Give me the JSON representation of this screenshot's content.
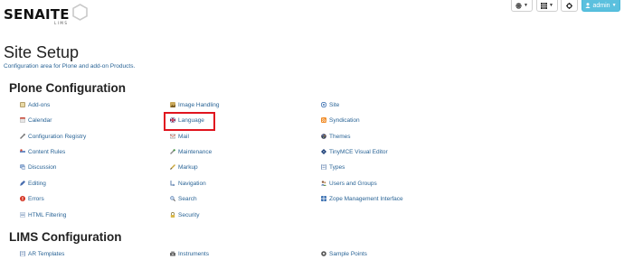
{
  "brand": {
    "name": "SENAITE",
    "sub": "LIMS"
  },
  "toolbar": {
    "admin_label": "admin"
  },
  "page": {
    "title": "Site Setup",
    "description": "Configuration area for Plone and add-on Products."
  },
  "plone_config": {
    "title": "Plone Configuration",
    "col1": [
      {
        "label": "Add-ons",
        "icon": "addons-icon"
      },
      {
        "label": "Calendar",
        "icon": "calendar-icon"
      },
      {
        "label": "Configuration Registry",
        "icon": "wrench-icon"
      },
      {
        "label": "Content Rules",
        "icon": "content-rules-icon"
      },
      {
        "label": "Discussion",
        "icon": "discussion-icon"
      },
      {
        "label": "Editing",
        "icon": "editing-icon"
      },
      {
        "label": "Errors",
        "icon": "errors-icon"
      },
      {
        "label": "HTML Filtering",
        "icon": "html-filtering-icon"
      }
    ],
    "col2": [
      {
        "label": "Image Handling",
        "icon": "image-icon"
      },
      {
        "label": "Language",
        "icon": "flag-icon"
      },
      {
        "label": "Mail",
        "icon": "mail-icon"
      },
      {
        "label": "Maintenance",
        "icon": "maintenance-icon"
      },
      {
        "label": "Markup",
        "icon": "markup-icon"
      },
      {
        "label": "Navigation",
        "icon": "navigation-icon"
      },
      {
        "label": "Search",
        "icon": "search-icon"
      },
      {
        "label": "Security",
        "icon": "lock-icon"
      }
    ],
    "col3": [
      {
        "label": "Site",
        "icon": "site-icon"
      },
      {
        "label": "Syndication",
        "icon": "rss-icon"
      },
      {
        "label": "Themes",
        "icon": "themes-icon"
      },
      {
        "label": "TinyMCE Visual Editor",
        "icon": "tinymce-icon"
      },
      {
        "label": "Types",
        "icon": "types-icon"
      },
      {
        "label": "Users and Groups",
        "icon": "users-icon"
      },
      {
        "label": "Zope Management Interface",
        "icon": "zope-icon"
      }
    ]
  },
  "lims_config": {
    "title": "LIMS Configuration",
    "col1": [
      {
        "label": "AR Templates",
        "icon": "ar-templates-icon"
      }
    ],
    "col2": [
      {
        "label": "Instruments",
        "icon": "instruments-icon"
      }
    ],
    "col3": [
      {
        "label": "Sample Points",
        "icon": "sample-points-icon"
      }
    ]
  }
}
